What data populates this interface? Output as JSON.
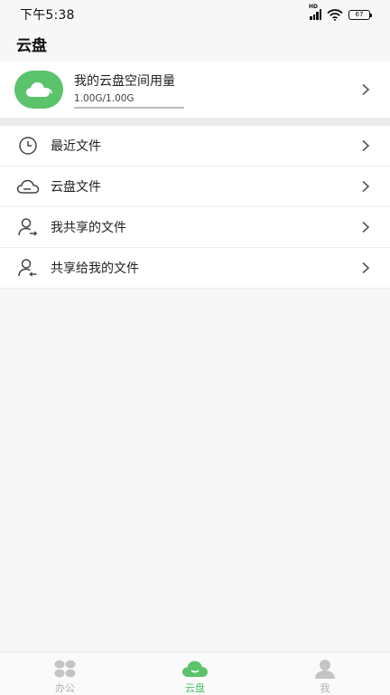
{
  "status_bar": {
    "time": "下午5:38",
    "network_label": "HD",
    "battery": "67"
  },
  "header": {
    "title": "云盘"
  },
  "storage": {
    "title": "我的云盘空间用量",
    "usage_text": "1.00G/1.00G",
    "usage_fraction": 1.0,
    "icon": "cloud-icon",
    "accent_color": "#5bc36b"
  },
  "menu": {
    "items": [
      {
        "label": "最近文件",
        "icon": "clock-icon"
      },
      {
        "label": "云盘文件",
        "icon": "cloud-outline-icon"
      },
      {
        "label": "我共享的文件",
        "icon": "user-share-out-icon"
      },
      {
        "label": "共享给我的文件",
        "icon": "user-share-in-icon"
      }
    ]
  },
  "bottom_nav": {
    "items": [
      {
        "label": "办公",
        "icon": "grid-icon",
        "active": false
      },
      {
        "label": "云盘",
        "icon": "cloud-icon",
        "active": true
      },
      {
        "label": "我",
        "icon": "person-icon",
        "active": false
      }
    ],
    "active_color": "#4cbf6a",
    "inactive_color": "#b0b0b0"
  }
}
